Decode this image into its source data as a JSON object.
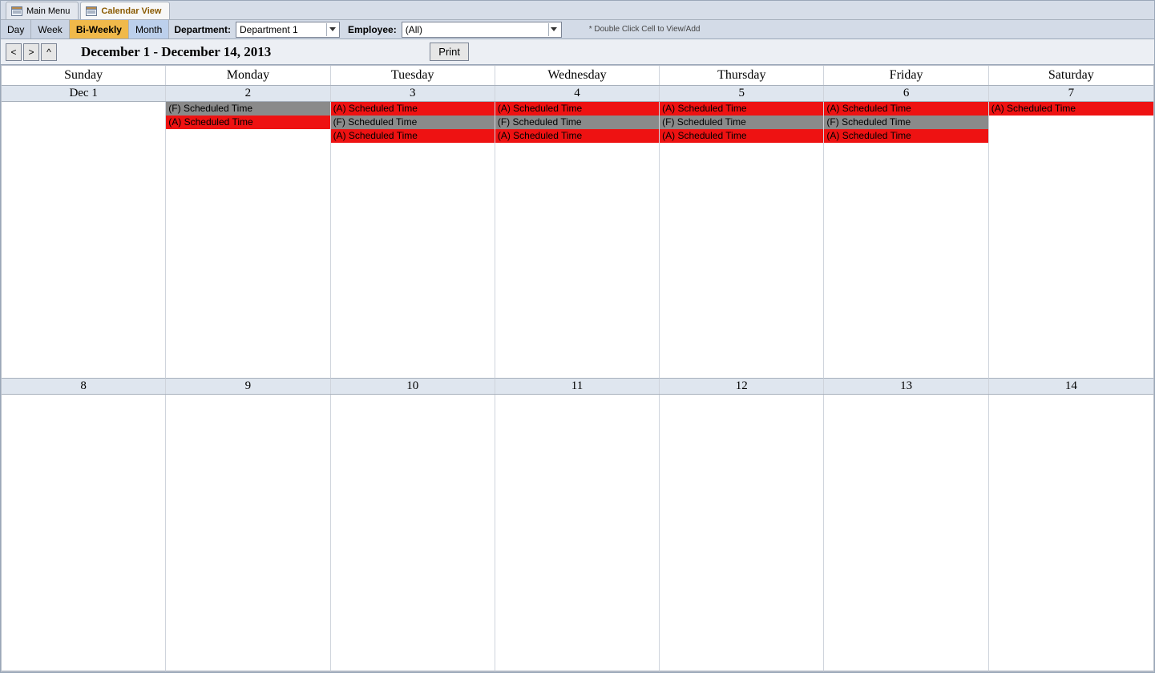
{
  "tabs": [
    {
      "label": "Main Menu",
      "active": false
    },
    {
      "label": "Calendar View",
      "active": true
    }
  ],
  "toolbar": {
    "views": {
      "day": "Day",
      "week": "Week",
      "biweekly": "Bi-Weekly",
      "month": "Month"
    },
    "selected_view": "biweekly",
    "department_label": "Department:",
    "department_value": "Department 1",
    "employee_label": "Employee:",
    "employee_value": "(All)",
    "hint": "* Double Click Cell to View/Add"
  },
  "header": {
    "nav_prev": "<",
    "nav_next": ">",
    "nav_up": "^",
    "date_range": "December 1 - December 14, 2013",
    "print_label": "Print"
  },
  "days_of_week": [
    "Sunday",
    "Monday",
    "Tuesday",
    "Wednesday",
    "Thursday",
    "Friday",
    "Saturday"
  ],
  "weeks": [
    {
      "dates": [
        "Dec 1",
        "2",
        "3",
        "4",
        "5",
        "6",
        "7"
      ],
      "cells": [
        [],
        [
          {
            "text": "(F) Scheduled Time",
            "color": "gray"
          },
          {
            "text": "(A) Scheduled Time",
            "color": "red"
          }
        ],
        [
          {
            "text": "(A) Scheduled Time",
            "color": "red"
          },
          {
            "text": "(F) Scheduled Time",
            "color": "gray"
          },
          {
            "text": "(A) Scheduled Time",
            "color": "red"
          }
        ],
        [
          {
            "text": "(A) Scheduled Time",
            "color": "red"
          },
          {
            "text": "(F) Scheduled Time",
            "color": "gray"
          },
          {
            "text": "(A) Scheduled Time",
            "color": "red"
          }
        ],
        [
          {
            "text": "(A) Scheduled Time",
            "color": "red"
          },
          {
            "text": "(F) Scheduled Time",
            "color": "gray"
          },
          {
            "text": "(A) Scheduled Time",
            "color": "red"
          }
        ],
        [
          {
            "text": "(A) Scheduled Time",
            "color": "red"
          },
          {
            "text": "(F) Scheduled Time",
            "color": "gray"
          },
          {
            "text": "(A) Scheduled Time",
            "color": "red"
          }
        ],
        [
          {
            "text": "(A) Scheduled Time",
            "color": "red"
          }
        ]
      ]
    },
    {
      "dates": [
        "8",
        "9",
        "10",
        "11",
        "12",
        "13",
        "14"
      ],
      "cells": [
        [],
        [],
        [],
        [],
        [],
        [],
        []
      ]
    }
  ]
}
